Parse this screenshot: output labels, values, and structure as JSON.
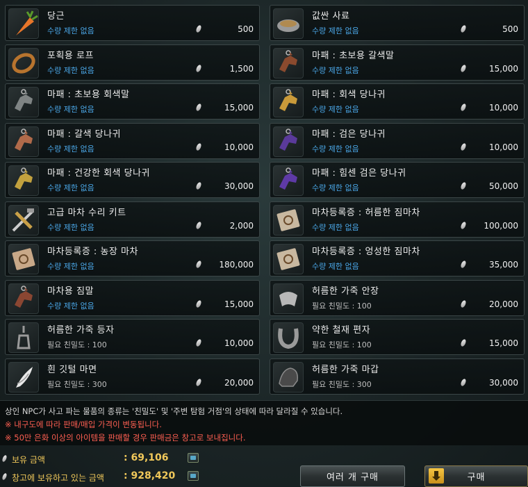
{
  "items": [
    {
      "name": "당근",
      "sub": "수량 제한 없음",
      "sub_type": "limit",
      "price": "500",
      "icon": "carrot-icon",
      "color": "#e8762a"
    },
    {
      "name": "값싼 사료",
      "sub": "수량 제한 없음",
      "sub_type": "limit",
      "price": "500",
      "icon": "feed-bowl-icon",
      "color": "#b08a50"
    },
    {
      "name": "포획용 로프",
      "sub": "수량 제한 없음",
      "sub_type": "limit",
      "price": "1,500",
      "icon": "rope-icon",
      "color": "#b8742e"
    },
    {
      "name": "마패 : 초보용 갈색말",
      "sub": "수량 제한 없음",
      "sub_type": "limit",
      "price": "15,000",
      "icon": "horse-tag-icon",
      "color": "#8a4a2e"
    },
    {
      "name": "마패 : 초보용 회색말",
      "sub": "수량 제한 없음",
      "sub_type": "limit",
      "price": "15,000",
      "icon": "horse-tag-icon",
      "color": "#7f8484"
    },
    {
      "name": "마패 : 회색 당나귀",
      "sub": "수량 제한 없음",
      "sub_type": "limit",
      "price": "10,000",
      "icon": "donkey-tag-icon",
      "color": "#c99a3a"
    },
    {
      "name": "마패 : 갈색 당나귀",
      "sub": "수량 제한 없음",
      "sub_type": "limit",
      "price": "10,000",
      "icon": "donkey-tag-icon",
      "color": "#b06a4a"
    },
    {
      "name": "마패 : 검은 당나귀",
      "sub": "수량 제한 없음",
      "sub_type": "limit",
      "price": "10,000",
      "icon": "donkey-tag-icon",
      "color": "#5a3a9a"
    },
    {
      "name": "마패 : 건강한 회색 당나귀",
      "sub": "수량 제한 없음",
      "sub_type": "limit",
      "price": "30,000",
      "icon": "donkey-tag-icon",
      "color": "#c2a13e"
    },
    {
      "name": "마패 : 힘센 검은 당나귀",
      "sub": "수량 제한 없음",
      "sub_type": "limit",
      "price": "50,000",
      "icon": "donkey-tag-icon",
      "color": "#5e3aa6"
    },
    {
      "name": "고급 마차 수리 키트",
      "sub": "수량 제한 없음",
      "sub_type": "limit",
      "price": "2,000",
      "icon": "repair-kit-icon",
      "color": "#c9a048"
    },
    {
      "name": "마차등록증 : 허름한 짐마차",
      "sub": "수량 제한 없음",
      "sub_type": "limit",
      "price": "100,000",
      "icon": "wagon-license-icon",
      "color": "#c8b8a0"
    },
    {
      "name": "마차등록증 : 농장 마차",
      "sub": "수량 제한 없음",
      "sub_type": "limit",
      "price": "180,000",
      "icon": "wagon-license-icon",
      "color": "#c8a888"
    },
    {
      "name": "마차등록증 : 엉성한 짐마차",
      "sub": "수량 제한 없음",
      "sub_type": "limit",
      "price": "35,000",
      "icon": "wagon-license-icon",
      "color": "#c8b8a0"
    },
    {
      "name": "마차용 짐말",
      "sub": "수량 제한 없음",
      "sub_type": "limit",
      "price": "15,000",
      "icon": "horse-tag-icon",
      "color": "#8a4632"
    },
    {
      "name": "허름한 가죽 안장",
      "sub": "필요 친밀도 : 100",
      "sub_type": "req",
      "price": "20,000",
      "icon": "saddle-icon",
      "color": "#b8b8b8"
    },
    {
      "name": "허름한 가죽 등자",
      "sub": "필요 친밀도 : 100",
      "sub_type": "req",
      "price": "10,000",
      "icon": "stirrup-icon",
      "color": "#3a3a3a"
    },
    {
      "name": "약한 철재 편자",
      "sub": "필요 친밀도 : 100",
      "sub_type": "req",
      "price": "15,000",
      "icon": "horseshoe-icon",
      "color": "#9a9a9a"
    },
    {
      "name": "흰 깃털 마면",
      "sub": "필요 친밀도 : 300",
      "sub_type": "req",
      "price": "20,000",
      "icon": "feather-mask-icon",
      "color": "#e8e8e8"
    },
    {
      "name": "허름한 가죽 마갑",
      "sub": "필요 친밀도 : 300",
      "sub_type": "req",
      "price": "30,000",
      "icon": "barding-icon",
      "color": "#4a4a4a"
    }
  ],
  "notice": {
    "line1": "상인 NPC가 사고 파는 물품의 종류는 '친밀도' 및 '주변 탐험 거점'의 상태에 따라 달라질 수 있습니다.",
    "line2": "※ 내구도에 따라 판매/매입 가격이 변동됩니다.",
    "line3": "※ 50만 은화 이상의 아이템을 판매할 경우 판매금은 창고로 보내집니다."
  },
  "wallet": {
    "held_label": "보유 금액",
    "held_value": ": 69,106",
    "storage_label": "창고에 보유하고 있는 금액",
    "storage_value": ": 928,420"
  },
  "buttons": {
    "multi_buy": "여러 개 구매",
    "buy": "구매"
  }
}
